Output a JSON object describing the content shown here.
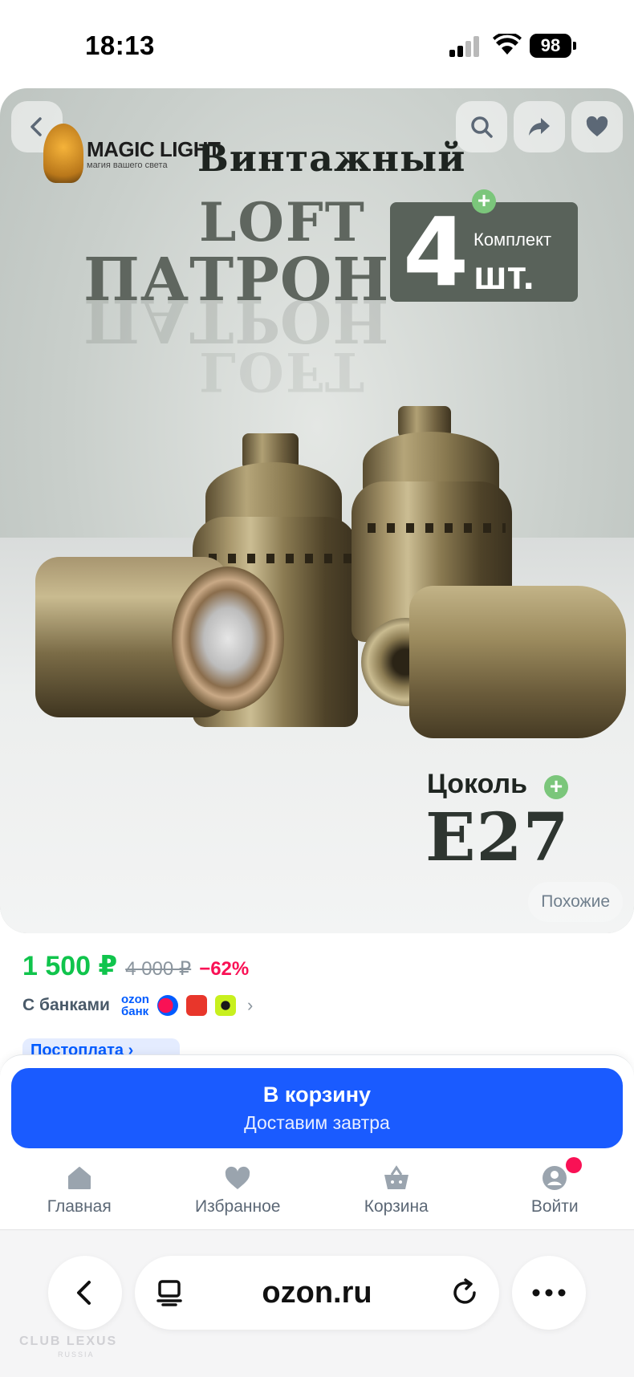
{
  "status_bar": {
    "time": "18:13",
    "battery": "98"
  },
  "product_image": {
    "logo_title": "MAGIC LIGHT",
    "logo_subtitle": "магия вашего света",
    "title_line1": "Винтажный",
    "title_line2": "LOFT",
    "title_line3": "ПАТРОН",
    "kit_number": "4",
    "kit_label": "Комплект",
    "kit_unit": "шт.",
    "base_label": "Цоколь",
    "base_value": "E27",
    "similar_label": "Похожие"
  },
  "price": {
    "current": "1 500 ₽",
    "old": "4 000 ₽",
    "discount": "−62%"
  },
  "banks": {
    "label": "С банками",
    "ozon_bank_line1": "ozon",
    "ozon_bank_line2": "банк"
  },
  "postpay": {
    "label": "Постоплата ›"
  },
  "cart_button": {
    "title": "В корзину",
    "subtitle": "Доставим завтра"
  },
  "tabbar": {
    "items": [
      {
        "label": "Главная",
        "icon": "home-icon"
      },
      {
        "label": "Избранное",
        "icon": "heart-icon"
      },
      {
        "label": "Корзина",
        "icon": "basket-icon"
      },
      {
        "label": "Войти",
        "icon": "user-icon"
      }
    ]
  },
  "browser": {
    "url": "ozon.ru"
  },
  "watermark": {
    "line1": "CLUB LEXUS",
    "line2": "RUSSIA"
  },
  "colors": {
    "accent": "#1a5bff",
    "price_green": "#10c44c",
    "discount_pink": "#f91155"
  }
}
